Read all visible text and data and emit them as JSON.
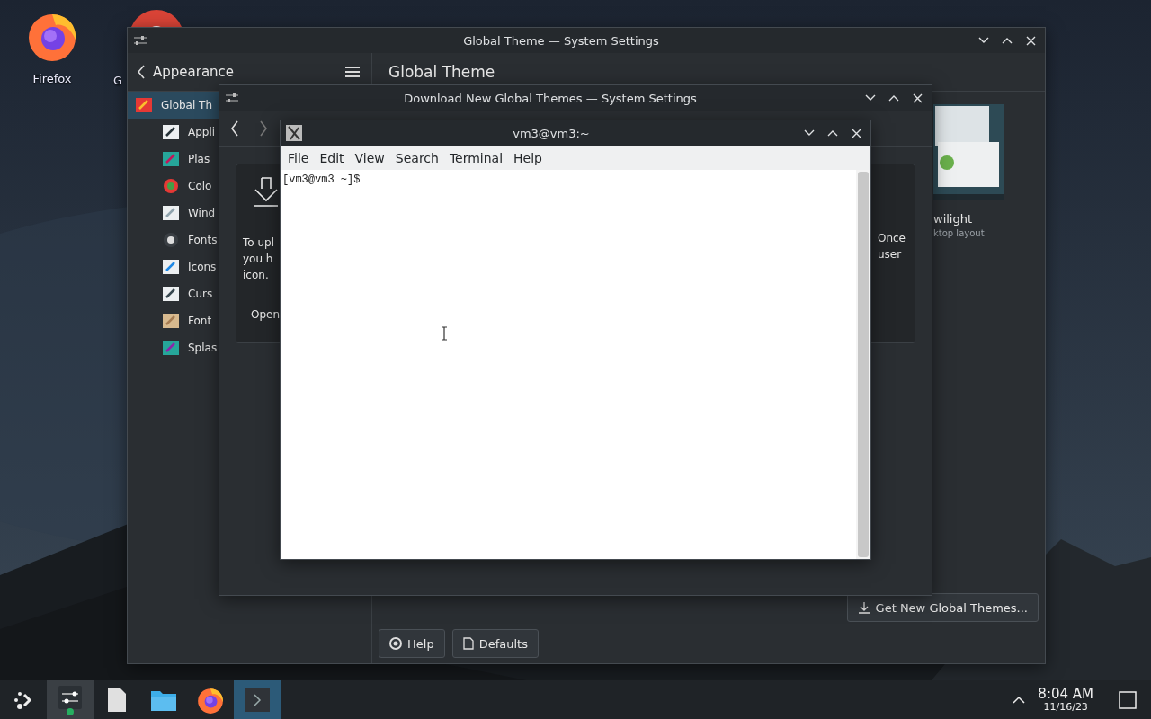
{
  "desktop_icons": [
    {
      "label": "Firefox",
      "kind": "firefox"
    },
    {
      "label": "G",
      "kind": "chrome"
    }
  ],
  "settings_window": {
    "title": "Global Theme — System Settings",
    "back_label": "Appearance",
    "page_title": "Global Theme",
    "sidebar": {
      "items": [
        {
          "label": "Global Th",
          "kind": "global",
          "selected": true
        },
        {
          "label": "Appli",
          "kind": "app",
          "selected": false
        },
        {
          "label": "Plas",
          "kind": "plasma",
          "selected": false
        },
        {
          "label": "Colo",
          "kind": "colors",
          "selected": false
        },
        {
          "label": "Wind",
          "kind": "window",
          "selected": false
        },
        {
          "label": "Fonts",
          "kind": "fonts",
          "selected": false
        },
        {
          "label": "Icons",
          "kind": "icons",
          "selected": false
        },
        {
          "label": "Curs",
          "kind": "cursors",
          "selected": false
        },
        {
          "label": "Font",
          "kind": "fontmgmt",
          "selected": false
        },
        {
          "label": "Splas",
          "kind": "splash",
          "selected": false
        }
      ]
    },
    "theme_preview": {
      "name": "wilight",
      "description": "ktop layout"
    },
    "get_new_button": "Get New Global Themes...",
    "footer_buttons": [
      {
        "label": "Help",
        "kind": "help"
      },
      {
        "label": "Defaults",
        "kind": "defaults"
      }
    ]
  },
  "download_window": {
    "title": "Download New Global Themes — System Settings",
    "card": {
      "left_lines": [
        "To upl",
        "you h",
        "icon."
      ],
      "right_lines": [
        "Once",
        "user"
      ],
      "button": "Open"
    }
  },
  "terminal": {
    "title": "vm3@vm3:~",
    "menu": [
      "File",
      "Edit",
      "View",
      "Search",
      "Terminal",
      "Help"
    ],
    "lines": [
      "[vm3@vm3 ~]$"
    ]
  },
  "taskbar": {
    "items": [
      {
        "kind": "launcher",
        "open": false,
        "selected": false
      },
      {
        "kind": "settings",
        "open": true,
        "selected": false
      },
      {
        "kind": "document",
        "open": false,
        "selected": false
      },
      {
        "kind": "folder",
        "open": false,
        "selected": false
      },
      {
        "kind": "firefox",
        "open": false,
        "selected": false
      },
      {
        "kind": "terminal",
        "open": true,
        "selected": true
      }
    ],
    "time": "8:04 AM",
    "date": "11/16/23"
  }
}
